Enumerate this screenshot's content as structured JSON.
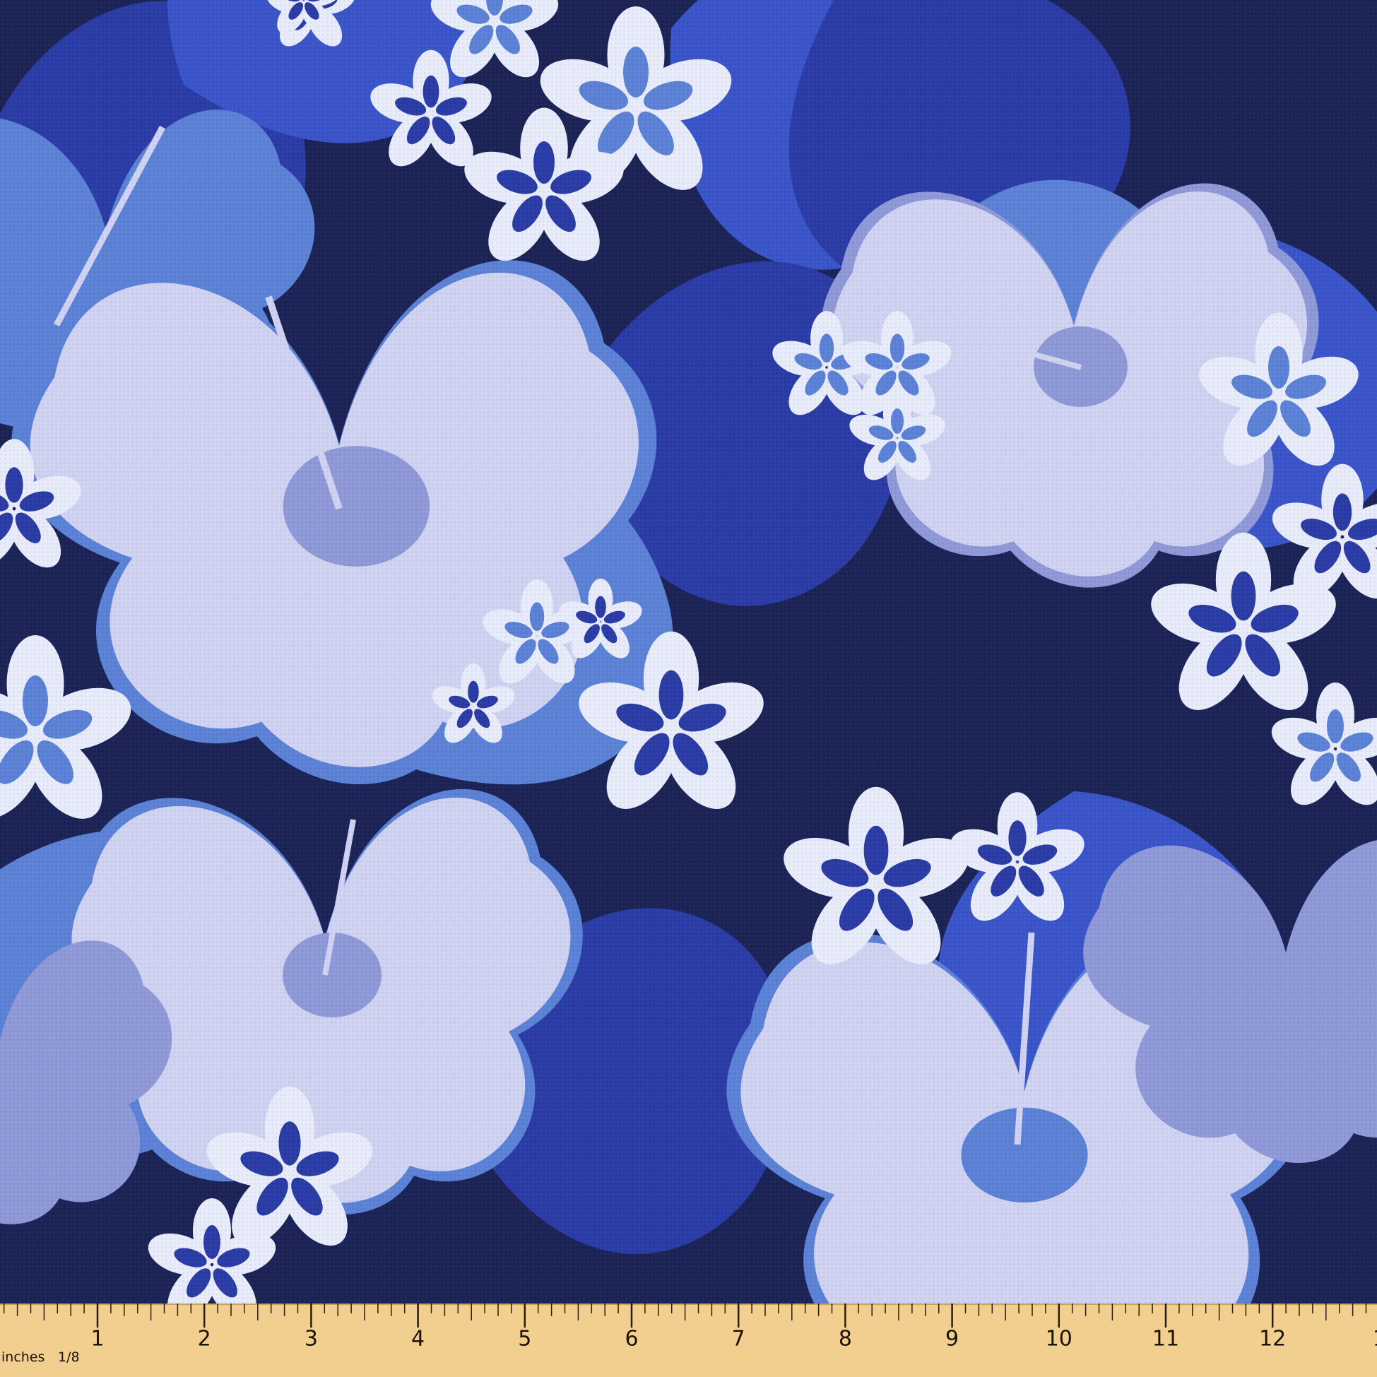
{
  "palette": {
    "background_navy": "#1c2457",
    "deep_blue": "#2b3ca6",
    "royal_blue": "#3a55c9",
    "leaf_blue": "#5b82d6",
    "periwinkle": "#8f99d8",
    "flower_light": "#cfd3f1",
    "flower_white": "#e8ebfa",
    "ruler_wood": "#f2cf8e"
  },
  "ruler": {
    "unit_label": "inches",
    "fraction_label": "1/8",
    "numbers": [
      "1",
      "2",
      "3",
      "4",
      "5",
      "6",
      "7",
      "8",
      "9",
      "10",
      "11",
      "12",
      "1"
    ]
  }
}
